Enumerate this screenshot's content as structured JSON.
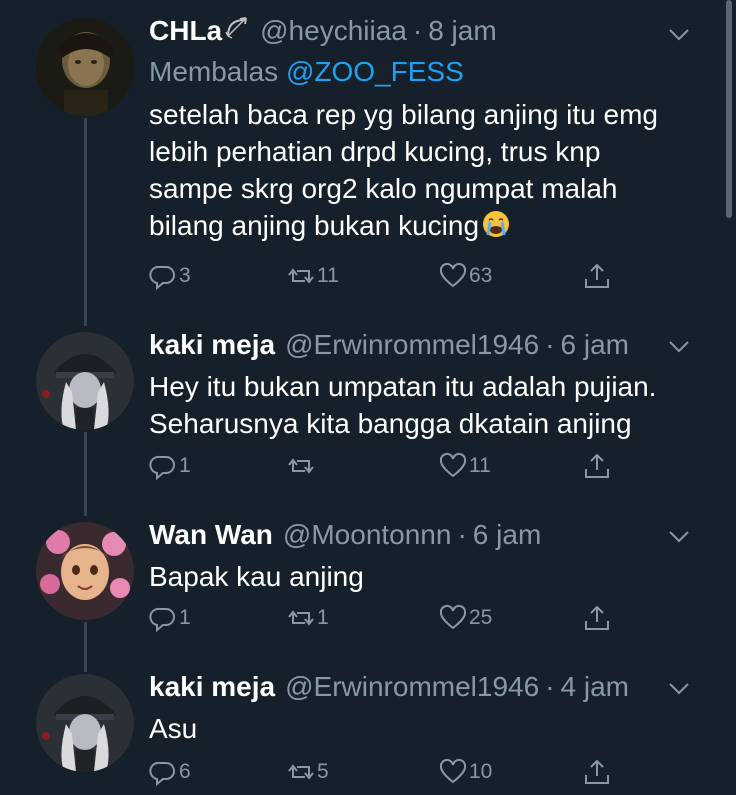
{
  "tweets": [
    {
      "name": "CHLa",
      "handle": "@heychiiaa",
      "separator": "·",
      "time": "8 jam",
      "replying_prefix": "Membalas",
      "replying_to": "@ZOO_FESS",
      "text": "setelah baca rep yg bilang anjing itu emg\nlebih perhatian drpd kucing, trus knp\nsampe skrg org2 kalo ngumpat malah\nbilang anjing bukan kucing",
      "replies": "3",
      "retweets": "11",
      "likes": "63"
    },
    {
      "name": "kaki meja",
      "handle": "@Erwinrommel1946",
      "separator": "·",
      "time": "6 jam",
      "text": "Hey itu bukan umpatan itu adalah pujian.\nSeharusnya kita bangga dkatain anjing",
      "replies": "1",
      "retweets": "",
      "likes": "11"
    },
    {
      "name": "Wan Wan",
      "handle": "@Moontonnn",
      "separator": "·",
      "time": "6 jam",
      "text": "Bapak kau anjing",
      "replies": "1",
      "retweets": "1",
      "likes": "25"
    },
    {
      "name": "kaki meja",
      "handle": "@Erwinrommel1946",
      "separator": "·",
      "time": "4 jam",
      "text": "Asu",
      "replies": "6",
      "retweets": "5",
      "likes": "10"
    }
  ],
  "icons": {
    "reply": "reply-icon",
    "retweet": "retweet-icon",
    "like": "heart-icon",
    "share": "share-icon",
    "menu": "chevron-down-icon"
  },
  "colors": {
    "background": "#15202b",
    "secondary_text": "#8899a6",
    "link": "#1da1f2",
    "thread_line": "#38444d"
  }
}
